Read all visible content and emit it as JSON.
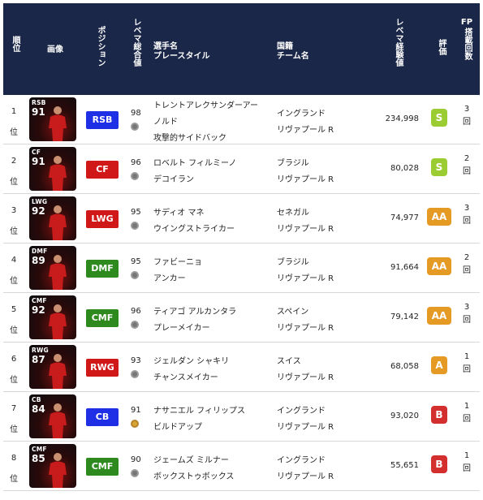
{
  "header": {
    "rank": "順位",
    "image": "画像",
    "position": "ポジション",
    "level_total": "レベマ総合値",
    "name_style_1": "選手名",
    "name_style_2": "プレースタイル",
    "nation_1": "国籍",
    "nation_2": "チーム名",
    "exp": "レベマ経験値",
    "eval": "評価",
    "fp": "FP搭載回数"
  },
  "colors": {
    "header_bg": "#1b2748",
    "RSB": "#1f2fe6",
    "CB": "#1f2fe6",
    "CF": "#d01818",
    "LWG": "#d01818",
    "RWG": "#d01818",
    "DMF": "#2e8a1f",
    "CMF": "#2e8a1f",
    "eval_S": "#9bcc32",
    "eval_AA": "#e59a24",
    "eval_A": "#e59a24",
    "eval_B": "#d42f2f"
  },
  "rows": [
    {
      "rank": "1",
      "rank_suffix": "位",
      "card_pos": "RSB",
      "card_rating": "91",
      "position": "RSB",
      "level": "98",
      "name_line1": "トレントアレクサンダーアー",
      "name_line2": "ノルド",
      "style": "攻撃的サイドバック",
      "nation": "イングランド",
      "team": "リヴァプール R",
      "exp": "234,998",
      "eval": "S",
      "fp": "3",
      "fp_unit": "回"
    },
    {
      "rank": "2",
      "rank_suffix": "位",
      "card_pos": "CF",
      "card_rating": "91",
      "position": "CF",
      "level": "96",
      "name_line1": "ロベルト フィルミーノ",
      "name_line2": "",
      "style": "デコイラン",
      "nation": "ブラジル",
      "team": "リヴァプール R",
      "exp": "80,028",
      "eval": "S",
      "fp": "2",
      "fp_unit": "回"
    },
    {
      "rank": "3",
      "rank_suffix": "位",
      "card_pos": "LWG",
      "card_rating": "92",
      "position": "LWG",
      "level": "95",
      "name_line1": "サディオ マネ",
      "name_line2": "",
      "style": "ウイングストライカー",
      "nation": "セネガル",
      "team": "リヴァプール R",
      "exp": "74,977",
      "eval": "AA",
      "fp": "3",
      "fp_unit": "回"
    },
    {
      "rank": "4",
      "rank_suffix": "位",
      "card_pos": "DMF",
      "card_rating": "89",
      "position": "DMF",
      "level": "95",
      "name_line1": "ファビーニョ",
      "name_line2": "",
      "style": "アンカー",
      "nation": "ブラジル",
      "team": "リヴァプール R",
      "exp": "91,664",
      "eval": "AA",
      "fp": "2",
      "fp_unit": "回"
    },
    {
      "rank": "5",
      "rank_suffix": "位",
      "card_pos": "CMF",
      "card_rating": "92",
      "position": "CMF",
      "level": "96",
      "name_line1": "ティアゴ アルカンタラ",
      "name_line2": "",
      "style": "プレーメイカー",
      "nation": "スペイン",
      "team": "リヴァプール R",
      "exp": "79,142",
      "eval": "AA",
      "fp": "3",
      "fp_unit": "回"
    },
    {
      "rank": "6",
      "rank_suffix": "位",
      "card_pos": "RWG",
      "card_rating": "87",
      "position": "RWG",
      "level": "93",
      "name_line1": "ジェルダン シャキリ",
      "name_line2": "",
      "style": "チャンスメイカー",
      "nation": "スイス",
      "team": "リヴァプール R",
      "exp": "68,058",
      "eval": "A",
      "fp": "1",
      "fp_unit": "回"
    },
    {
      "rank": "7",
      "rank_suffix": "位",
      "card_pos": "CB",
      "card_rating": "84",
      "position": "CB",
      "level": "91",
      "name_line1": "ナサニエル フィリップス",
      "name_line2": "",
      "style": "ビルドアップ",
      "nation": "イングランド",
      "team": "リヴァプール R",
      "exp": "93,020",
      "eval": "B",
      "fp": "1",
      "fp_unit": "回",
      "gold": true
    },
    {
      "rank": "8",
      "rank_suffix": "位",
      "card_pos": "CMF",
      "card_rating": "85",
      "position": "CMF",
      "level": "90",
      "name_line1": "ジェームズ ミルナー",
      "name_line2": "",
      "style": "ボックストゥボックス",
      "nation": "イングランド",
      "team": "リヴァプール R",
      "exp": "55,651",
      "eval": "B",
      "fp": "1",
      "fp_unit": "回"
    }
  ]
}
